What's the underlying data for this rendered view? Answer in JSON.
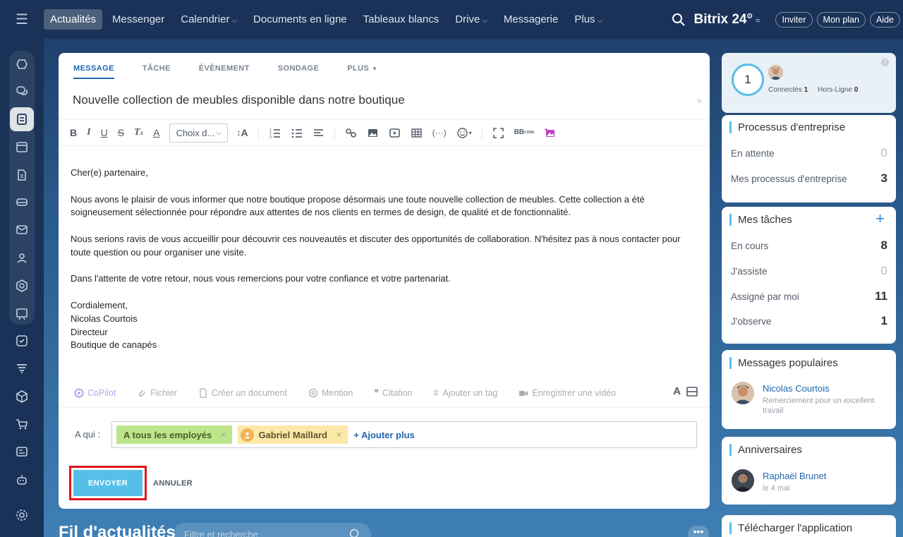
{
  "nav": {
    "items": [
      {
        "label": "Actualités",
        "active": true,
        "dropdown": false
      },
      {
        "label": "Messenger",
        "active": false,
        "dropdown": false
      },
      {
        "label": "Calendrier",
        "active": false,
        "dropdown": true
      },
      {
        "label": "Documents en ligne",
        "active": false,
        "dropdown": false
      },
      {
        "label": "Tableaux blancs",
        "active": false,
        "dropdown": false
      },
      {
        "label": "Drive",
        "active": false,
        "dropdown": true
      },
      {
        "label": "Messagerie",
        "active": false,
        "dropdown": false
      },
      {
        "label": "Plus",
        "active": false,
        "dropdown": true
      }
    ],
    "brand": "Bitrix 24",
    "invite": "Inviter",
    "plan": "Mon plan",
    "help": "Aide"
  },
  "composer": {
    "tabs": [
      "MESSAGE",
      "TÂCHE",
      "ÉVÈNEMENT",
      "SONDAGE",
      "PLUS"
    ],
    "subject": "Nouvelle collection de meubles disponible dans notre boutique",
    "font_select": "Choix d...",
    "body": [
      "Cher(e) partenaire,",
      "Nous avons le plaisir de vous informer que notre boutique propose désormais une toute nouvelle collection de meubles. Cette collection a été soigneusement sélectionnée pour répondre aux attentes de nos clients en termes de design, de qualité et de fonctionnalité.",
      "Nous serions ravis de vous accueillir pour découvrir ces nouveautés et discuter des opportunités de collaboration. N'hésitez pas à nous contacter pour toute question ou pour organiser une visite.",
      "Dans l'attente de votre retour, nous vous remercions pour votre confiance et votre partenariat."
    ],
    "signature": [
      "Cordialement,",
      "Nicolas Courtois",
      "Directeur",
      "Boutique de canapés"
    ],
    "attach": {
      "copilot": "CoPilot",
      "file": "Fichier",
      "create_doc": "Créer un document",
      "mention": "Mention",
      "quote": "Citation",
      "tag": "Ajouter un tag",
      "video": "Enregistrer une vidéo"
    },
    "to_label": "A qui :",
    "recipients": {
      "all": "A tous les employés",
      "user": "Gabriel Maillard"
    },
    "add_more": "+ Ajouter plus",
    "send": "ENVOYER",
    "cancel": "ANNULER"
  },
  "feed": {
    "title": "Fil d'actualités",
    "search_placeholder": "Filtre et recherche"
  },
  "right": {
    "online": {
      "count": "1",
      "connected_label": "Connectés",
      "connected": "1",
      "offline_label": "Hors-Ligne",
      "offline": "0"
    },
    "business": {
      "title": "Processus d'entreprise",
      "rows": [
        {
          "label": "En attente",
          "value": "0"
        },
        {
          "label": "Mes processus d'entreprise",
          "value": "3"
        }
      ]
    },
    "tasks": {
      "title": "Mes tâches",
      "rows": [
        {
          "label": "En cours",
          "value": "8"
        },
        {
          "label": "J'assiste",
          "value": "0"
        },
        {
          "label": "Assigné par moi",
          "value": "11"
        },
        {
          "label": "J'observe",
          "value": "1"
        }
      ]
    },
    "popular": {
      "title": "Messages populaires",
      "name": "Nicolas Courtois",
      "text": "Remerciement pour un excellent travail"
    },
    "birthdays": {
      "title": "Anniversaires",
      "name": "Raphaël Brunet",
      "date": "le 4 mai"
    },
    "download": {
      "title": "Télécharger l'application"
    }
  }
}
